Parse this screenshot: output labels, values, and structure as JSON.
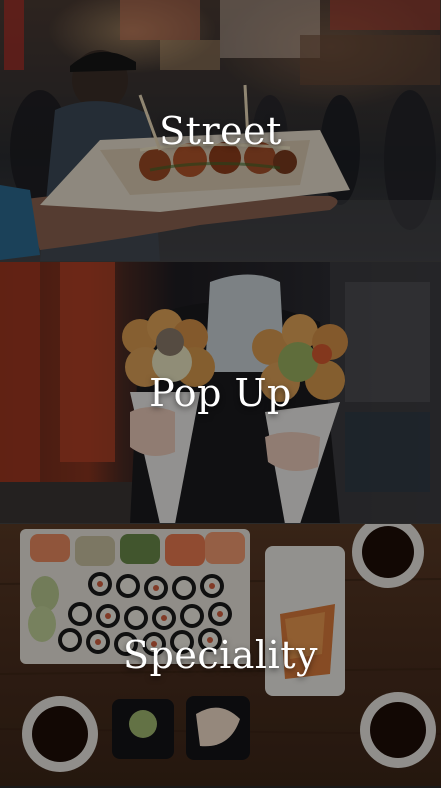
{
  "panels": [
    {
      "label": "Street"
    },
    {
      "label": "Pop Up"
    },
    {
      "label": "Speciality"
    }
  ]
}
